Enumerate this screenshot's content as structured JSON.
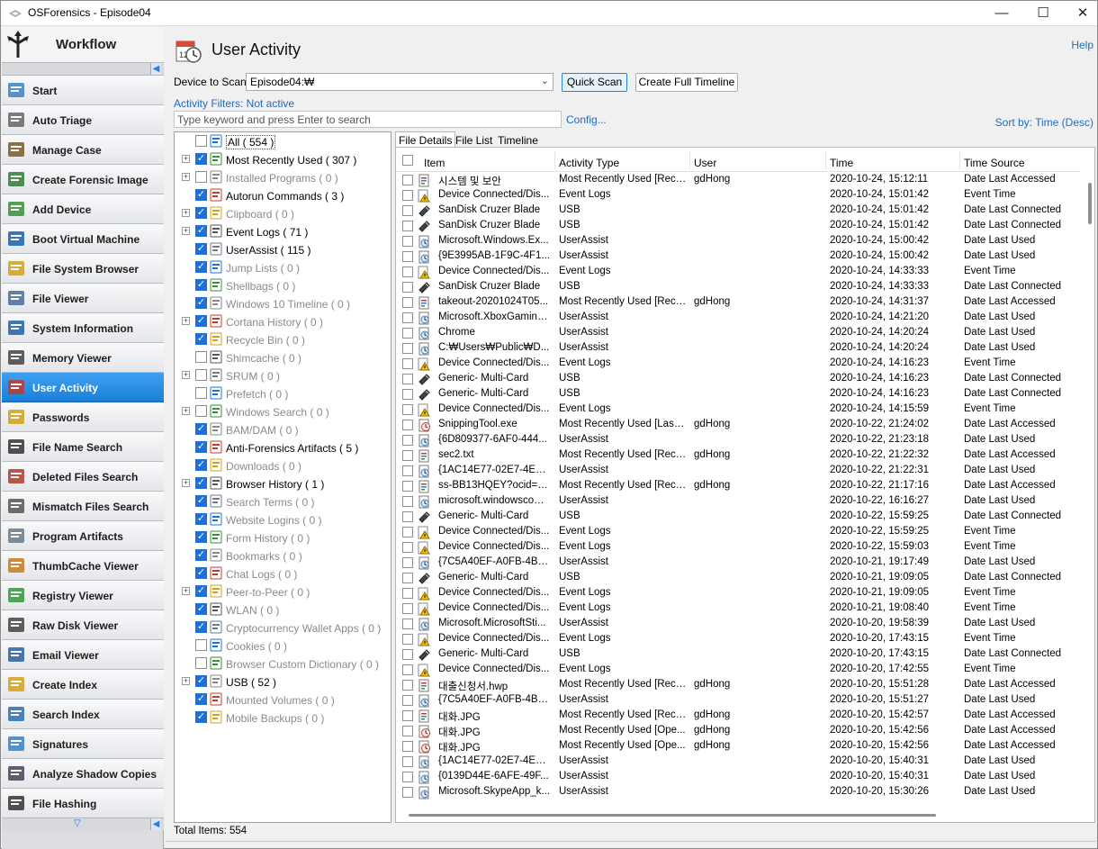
{
  "window": {
    "title": "OSForensics - Episode04",
    "minimize": "—",
    "maximize": "☐",
    "close": "✕"
  },
  "sidebar": {
    "header": "Workflow",
    "items": [
      {
        "label": "Start",
        "icon": "start-icon"
      },
      {
        "label": "Auto Triage",
        "icon": "fingerprint-icon"
      },
      {
        "label": "Manage Case",
        "icon": "case-icon"
      },
      {
        "label": "Create Forensic Image",
        "icon": "drive-plus-icon"
      },
      {
        "label": "Add Device",
        "icon": "add-device-icon"
      },
      {
        "label": "Boot Virtual Machine",
        "icon": "vm-icon"
      },
      {
        "label": "File System Browser",
        "icon": "folder-icon"
      },
      {
        "label": "File Viewer",
        "icon": "file-viewer-icon"
      },
      {
        "label": "System Information",
        "icon": "system-info-icon"
      },
      {
        "label": "Memory Viewer",
        "icon": "memory-icon"
      },
      {
        "label": "User Activity",
        "icon": "user-activity-icon",
        "active": true
      },
      {
        "label": "Passwords",
        "icon": "key-icon"
      },
      {
        "label": "File Name Search",
        "icon": "binoculars-icon"
      },
      {
        "label": "Deleted Files Search",
        "icon": "deleted-file-icon"
      },
      {
        "label": "Mismatch Files Search",
        "icon": "abc-icon"
      },
      {
        "label": "Program Artifacts",
        "icon": "program-icon"
      },
      {
        "label": "ThumbCache Viewer",
        "icon": "thumbcache-icon"
      },
      {
        "label": "Registry Viewer",
        "icon": "registry-icon"
      },
      {
        "label": "Raw Disk Viewer",
        "icon": "raw-disk-icon"
      },
      {
        "label": "Email Viewer",
        "icon": "email-icon"
      },
      {
        "label": "Create Index",
        "icon": "create-index-icon"
      },
      {
        "label": "Search Index",
        "icon": "search-index-icon"
      },
      {
        "label": "Signatures",
        "icon": "signatures-icon"
      },
      {
        "label": "Analyze Shadow Copies",
        "icon": "shadow-copy-icon"
      },
      {
        "label": "File Hashing",
        "icon": "hash-icon"
      }
    ]
  },
  "page": {
    "title": "User Activity",
    "help": "Help",
    "device_label": "Device to Scan:",
    "device_value": "Episode04:₩",
    "quick_scan": "Quick Scan",
    "full_timeline": "Create Full Timeline",
    "filters": "Activity Filters: Not active",
    "keyword_placeholder": "Type keyword and press Enter to search",
    "config": "Config...",
    "sort": "Sort by: Time (Desc)",
    "status": "Total Items: 554"
  },
  "tree": [
    {
      "label": "All ( 554 )",
      "checked": false,
      "dim": false,
      "expander": false,
      "indent": 0,
      "icon": "all-icon"
    },
    {
      "label": "Most Recently Used ( 307 )",
      "checked": true,
      "dim": false,
      "expander": true,
      "indent": 1,
      "icon": "mru-icon"
    },
    {
      "label": "Installed Programs ( 0 )",
      "checked": false,
      "dim": true,
      "expander": true,
      "indent": 1,
      "icon": "installed-icon"
    },
    {
      "label": "Autorun Commands ( 3 )",
      "checked": true,
      "dim": false,
      "expander": false,
      "indent": 1,
      "icon": "autorun-icon"
    },
    {
      "label": "Clipboard ( 0 )",
      "checked": true,
      "dim": true,
      "expander": true,
      "indent": 1,
      "icon": "clipboard-icon"
    },
    {
      "label": "Event Logs ( 71 )",
      "checked": true,
      "dim": false,
      "expander": true,
      "indent": 1,
      "icon": "eventlog-icon"
    },
    {
      "label": "UserAssist ( 115 )",
      "checked": true,
      "dim": false,
      "expander": false,
      "indent": 1,
      "icon": "userassist-icon"
    },
    {
      "label": "Jump Lists ( 0 )",
      "checked": true,
      "dim": true,
      "expander": false,
      "indent": 1,
      "icon": "jumplist-icon"
    },
    {
      "label": "Shellbags ( 0 )",
      "checked": true,
      "dim": true,
      "expander": false,
      "indent": 1,
      "icon": "shellbags-icon"
    },
    {
      "label": "Windows 10 Timeline ( 0 )",
      "checked": true,
      "dim": true,
      "expander": false,
      "indent": 1,
      "icon": "timeline-icon"
    },
    {
      "label": "Cortana History ( 0 )",
      "checked": true,
      "dim": true,
      "expander": true,
      "indent": 1,
      "icon": "cortana-icon"
    },
    {
      "label": "Recycle Bin ( 0 )",
      "checked": true,
      "dim": true,
      "expander": false,
      "indent": 1,
      "icon": "recycle-icon"
    },
    {
      "label": "Shimcache ( 0 )",
      "checked": false,
      "dim": true,
      "expander": false,
      "indent": 1,
      "icon": "shimcache-icon"
    },
    {
      "label": "SRUM ( 0 )",
      "checked": false,
      "dim": true,
      "expander": true,
      "indent": 1,
      "icon": "srum-icon"
    },
    {
      "label": "Prefetch ( 0 )",
      "checked": false,
      "dim": true,
      "expander": false,
      "indent": 1,
      "icon": "prefetch-icon"
    },
    {
      "label": "Windows Search ( 0 )",
      "checked": false,
      "dim": true,
      "expander": true,
      "indent": 1,
      "icon": "winsearch-icon"
    },
    {
      "label": "BAM/DAM ( 0 )",
      "checked": true,
      "dim": true,
      "expander": false,
      "indent": 1,
      "icon": "bam-icon"
    },
    {
      "label": "Anti-Forensics Artifacts ( 5 )",
      "checked": true,
      "dim": false,
      "expander": false,
      "indent": 1,
      "icon": "antiforensics-icon"
    },
    {
      "label": "Downloads ( 0 )",
      "checked": true,
      "dim": true,
      "expander": false,
      "indent": 1,
      "icon": "downloads-icon"
    },
    {
      "label": "Browser History ( 1 )",
      "checked": true,
      "dim": false,
      "expander": true,
      "indent": 1,
      "icon": "browser-icon"
    },
    {
      "label": "Search Terms ( 0 )",
      "checked": true,
      "dim": true,
      "expander": false,
      "indent": 1,
      "icon": "searchterms-icon"
    },
    {
      "label": "Website Logins ( 0 )",
      "checked": true,
      "dim": true,
      "expander": false,
      "indent": 1,
      "icon": "logins-icon"
    },
    {
      "label": "Form History ( 0 )",
      "checked": true,
      "dim": true,
      "expander": false,
      "indent": 1,
      "icon": "formhistory-icon"
    },
    {
      "label": "Bookmarks ( 0 )",
      "checked": true,
      "dim": true,
      "expander": false,
      "indent": 1,
      "icon": "bookmark-icon"
    },
    {
      "label": "Chat Logs ( 0 )",
      "checked": true,
      "dim": true,
      "expander": false,
      "indent": 1,
      "icon": "chat-icon"
    },
    {
      "label": "Peer-to-Peer ( 0 )",
      "checked": true,
      "dim": true,
      "expander": true,
      "indent": 1,
      "icon": "p2p-icon"
    },
    {
      "label": "WLAN ( 0 )",
      "checked": true,
      "dim": true,
      "expander": false,
      "indent": 1,
      "icon": "wlan-icon"
    },
    {
      "label": "Cryptocurrency Wallet Apps ( 0 )",
      "checked": true,
      "dim": true,
      "expander": false,
      "indent": 1,
      "icon": "crypto-icon"
    },
    {
      "label": "Cookies ( 0 )",
      "checked": false,
      "dim": true,
      "expander": false,
      "indent": 1,
      "icon": "cookie-icon"
    },
    {
      "label": "Browser Custom Dictionary ( 0 )",
      "checked": false,
      "dim": true,
      "expander": false,
      "indent": 1,
      "icon": "dictionary-icon"
    },
    {
      "label": "USB ( 52 )",
      "checked": true,
      "dim": false,
      "expander": true,
      "indent": 1,
      "icon": "usb-icon"
    },
    {
      "label": "Mounted Volumes ( 0 )",
      "checked": true,
      "dim": true,
      "expander": false,
      "indent": 1,
      "icon": "volume-icon"
    },
    {
      "label": "Mobile Backups ( 0 )",
      "checked": true,
      "dim": true,
      "expander": false,
      "indent": 1,
      "icon": "mobile-icon"
    }
  ],
  "tabs": [
    "File Details",
    "File List",
    "Timeline"
  ],
  "columns": [
    "Item",
    "Activity Type",
    "User",
    "Time",
    "Time Source"
  ],
  "rows": [
    [
      "시스템 및 보안",
      "Most Recently Used [Rece...",
      "gdHong",
      "2020-10-24, 15:12:11",
      "Date Last Accessed",
      "doc"
    ],
    [
      "Device Connected/Dis...",
      "Event Logs",
      "",
      "2020-10-24, 15:01:42",
      "Event Time",
      "warn"
    ],
    [
      "SanDisk Cruzer Blade",
      "USB",
      "",
      "2020-10-24, 15:01:42",
      "Date Last Connected",
      "usb"
    ],
    [
      "SanDisk Cruzer Blade",
      "USB",
      "",
      "2020-10-24, 15:01:42",
      "Date Last Connected",
      "usb"
    ],
    [
      "Microsoft.Windows.Ex...",
      "UserAssist",
      "",
      "2020-10-24, 15:00:42",
      "Date Last Used",
      "ua"
    ],
    [
      "{9E3995AB-1F9C-4F1...",
      "UserAssist",
      "",
      "2020-10-24, 15:00:42",
      "Date Last Used",
      "ua"
    ],
    [
      "Device Connected/Dis...",
      "Event Logs",
      "",
      "2020-10-24, 14:33:33",
      "Event Time",
      "warn"
    ],
    [
      "SanDisk Cruzer Blade",
      "USB",
      "",
      "2020-10-24, 14:33:33",
      "Date Last Connected",
      "usb"
    ],
    [
      "takeout-20201024T05...",
      "Most Recently Used [Rece...",
      "gdHong",
      "2020-10-24, 14:31:37",
      "Date Last Accessed",
      "doc"
    ],
    [
      "Microsoft.XboxGaming...",
      "UserAssist",
      "",
      "2020-10-24, 14:21:20",
      "Date Last Used",
      "ua"
    ],
    [
      "Chrome",
      "UserAssist",
      "",
      "2020-10-24, 14:20:24",
      "Date Last Used",
      "ua"
    ],
    [
      "C:₩Users₩Public₩D...",
      "UserAssist",
      "",
      "2020-10-24, 14:20:24",
      "Date Last Used",
      "ua"
    ],
    [
      "Device Connected/Dis...",
      "Event Logs",
      "",
      "2020-10-24, 14:16:23",
      "Event Time",
      "warn"
    ],
    [
      "Generic- Multi-Card",
      "USB",
      "",
      "2020-10-24, 14:16:23",
      "Date Last Connected",
      "usb"
    ],
    [
      "Generic- Multi-Card",
      "USB",
      "",
      "2020-10-24, 14:16:23",
      "Date Last Connected",
      "usb"
    ],
    [
      "Device Connected/Dis...",
      "Event Logs",
      "",
      "2020-10-24, 14:15:59",
      "Event Time",
      "warn"
    ],
    [
      "SnippingTool.exe",
      "Most Recently Used [Last ...",
      "gdHong",
      "2020-10-22, 21:24:02",
      "Date Last Accessed",
      "mru"
    ],
    [
      "{6D809377-6AF0-444...",
      "UserAssist",
      "",
      "2020-10-22, 21:23:18",
      "Date Last Used",
      "ua"
    ],
    [
      "sec2.txt",
      "Most Recently Used [Rece...",
      "gdHong",
      "2020-10-22, 21:22:32",
      "Date Last Accessed",
      "doc"
    ],
    [
      "{1AC14E77-02E7-4E5...",
      "UserAssist",
      "",
      "2020-10-22, 21:22:31",
      "Date Last Used",
      "ua"
    ],
    [
      "ss-BB13HQEY?ocid=e...",
      "Most Recently Used [Rece...",
      "gdHong",
      "2020-10-22, 21:17:16",
      "Date Last Accessed",
      "doc"
    ],
    [
      "microsoft.windowscom...",
      "UserAssist",
      "",
      "2020-10-22, 16:16:27",
      "Date Last Used",
      "ua"
    ],
    [
      "Generic- Multi-Card",
      "USB",
      "",
      "2020-10-22, 15:59:25",
      "Date Last Connected",
      "usb"
    ],
    [
      "Device Connected/Dis...",
      "Event Logs",
      "",
      "2020-10-22, 15:59:25",
      "Event Time",
      "warn"
    ],
    [
      "Device Connected/Dis...",
      "Event Logs",
      "",
      "2020-10-22, 15:59:03",
      "Event Time",
      "warn"
    ],
    [
      "{7C5A40EF-A0FB-4BF...",
      "UserAssist",
      "",
      "2020-10-21, 19:17:49",
      "Date Last Used",
      "ua"
    ],
    [
      "Generic- Multi-Card",
      "USB",
      "",
      "2020-10-21, 19:09:05",
      "Date Last Connected",
      "usb"
    ],
    [
      "Device Connected/Dis...",
      "Event Logs",
      "",
      "2020-10-21, 19:09:05",
      "Event Time",
      "warn"
    ],
    [
      "Device Connected/Dis...",
      "Event Logs",
      "",
      "2020-10-21, 19:08:40",
      "Event Time",
      "warn"
    ],
    [
      "Microsoft.MicrosoftSti...",
      "UserAssist",
      "",
      "2020-10-20, 19:58:39",
      "Date Last Used",
      "ua"
    ],
    [
      "Device Connected/Dis...",
      "Event Logs",
      "",
      "2020-10-20, 17:43:15",
      "Event Time",
      "warn"
    ],
    [
      "Generic- Multi-Card",
      "USB",
      "",
      "2020-10-20, 17:43:15",
      "Date Last Connected",
      "usb"
    ],
    [
      "Device Connected/Dis...",
      "Event Logs",
      "",
      "2020-10-20, 17:42:55",
      "Event Time",
      "warn"
    ],
    [
      "대출신청서.hwp",
      "Most Recently Used [Rece...",
      "gdHong",
      "2020-10-20, 15:51:28",
      "Date Last Accessed",
      "doc"
    ],
    [
      "{7C5A40EF-A0FB-4BF...",
      "UserAssist",
      "",
      "2020-10-20, 15:51:27",
      "Date Last Used",
      "ua"
    ],
    [
      "대화.JPG",
      "Most Recently Used [Rece...",
      "gdHong",
      "2020-10-20, 15:42:57",
      "Date Last Accessed",
      "doc"
    ],
    [
      "대화.JPG",
      "Most Recently Used [Ope...",
      "gdHong",
      "2020-10-20, 15:42:56",
      "Date Last Accessed",
      "mru"
    ],
    [
      "대화.JPG",
      "Most Recently Used [Ope...",
      "gdHong",
      "2020-10-20, 15:42:56",
      "Date Last Accessed",
      "mru"
    ],
    [
      "{1AC14E77-02E7-4E5...",
      "UserAssist",
      "",
      "2020-10-20, 15:40:31",
      "Date Last Used",
      "ua"
    ],
    [
      "{0139D44E-6AFE-49F...",
      "UserAssist",
      "",
      "2020-10-20, 15:40:31",
      "Date Last Used",
      "ua"
    ],
    [
      "Microsoft.SkypeApp_k...",
      "UserAssist",
      "",
      "2020-10-20, 15:30:26",
      "Date Last Used",
      "ua"
    ]
  ]
}
